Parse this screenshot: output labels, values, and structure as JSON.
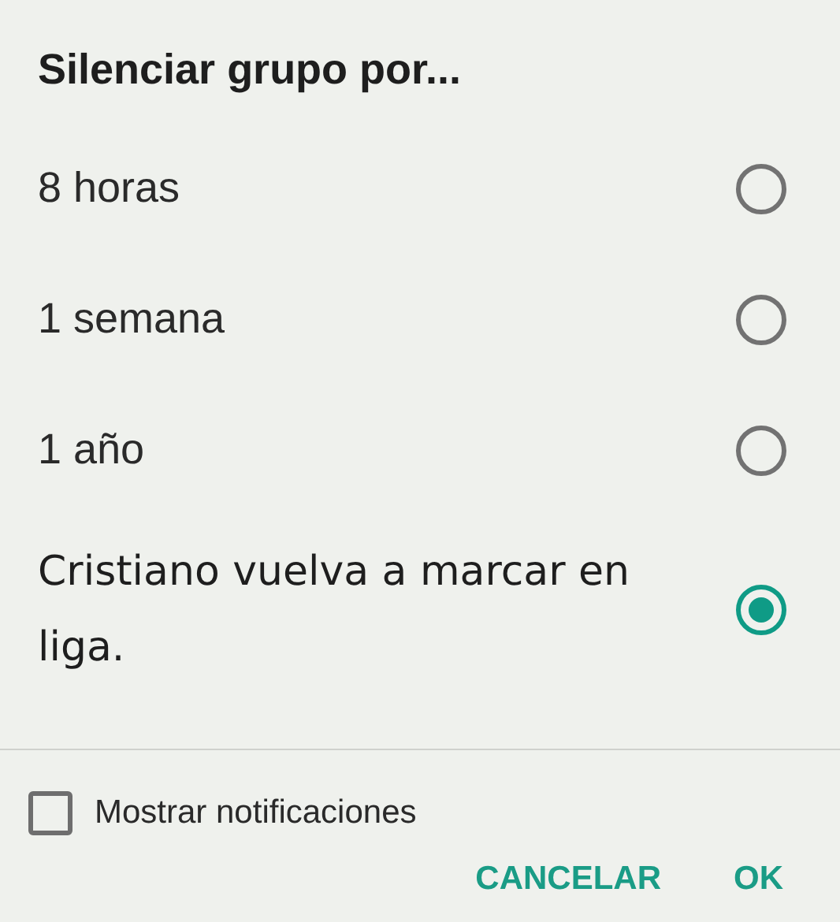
{
  "dialog": {
    "title": "Silenciar grupo por...",
    "options": [
      {
        "label": "8 horas",
        "selected": false,
        "kind": "plain"
      },
      {
        "label": "1 semana",
        "selected": false,
        "kind": "plain"
      },
      {
        "label": "1 año",
        "selected": false,
        "kind": "plain"
      },
      {
        "label": "Cristiano vuelva a marcar en liga.",
        "selected": true,
        "kind": "custom"
      }
    ],
    "checkbox": {
      "label": "Mostrar notificaciones",
      "checked": false
    },
    "buttons": [
      "CANCELAR",
      "OK"
    ]
  }
}
